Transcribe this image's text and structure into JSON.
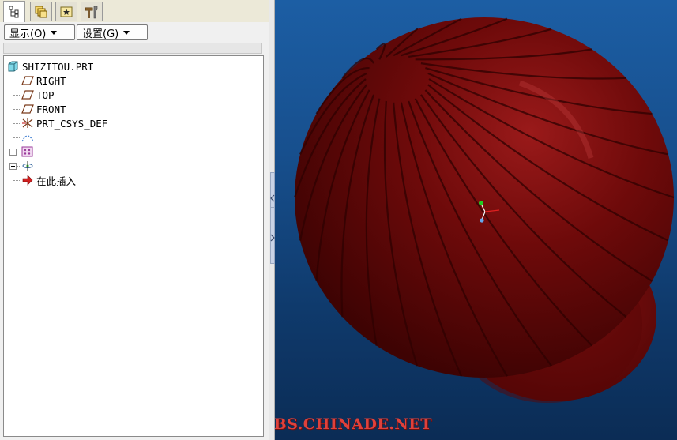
{
  "tabs": [
    {
      "icon": "model-tree-icon",
      "active": true
    },
    {
      "icon": "layers-icon",
      "active": false
    },
    {
      "icon": "folder-star-icon",
      "active": false
    },
    {
      "icon": "toolbox-icon",
      "active": false
    }
  ],
  "menu": {
    "display_label": "显示(O)",
    "settings_label": "设置(G)"
  },
  "tree": {
    "root": "SHIZITOU.PRT",
    "items": [
      {
        "label": "RIGHT",
        "icon": "datum-plane-icon"
      },
      {
        "label": "TOP",
        "icon": "datum-plane-icon"
      },
      {
        "label": "FRONT",
        "icon": "datum-plane-icon"
      },
      {
        "label": "PRT_CSYS_DEF",
        "icon": "coordinate-system-icon"
      },
      {
        "label": "",
        "icon": "datum-curve-icon"
      },
      {
        "label": "",
        "icon": "pattern-feature-icon",
        "expandable": true
      },
      {
        "label": "",
        "icon": "revolve-feature-icon",
        "expandable": true
      },
      {
        "label": "在此插入",
        "icon": "insert-here-arrow-icon"
      }
    ]
  },
  "colors": {
    "part": "#6e0a0a",
    "viewport_top": "#1c5ea4",
    "viewport_bottom": "#0b2c55",
    "watermark": "#e0413b"
  },
  "watermark": "BBS.CHINADE.NET"
}
